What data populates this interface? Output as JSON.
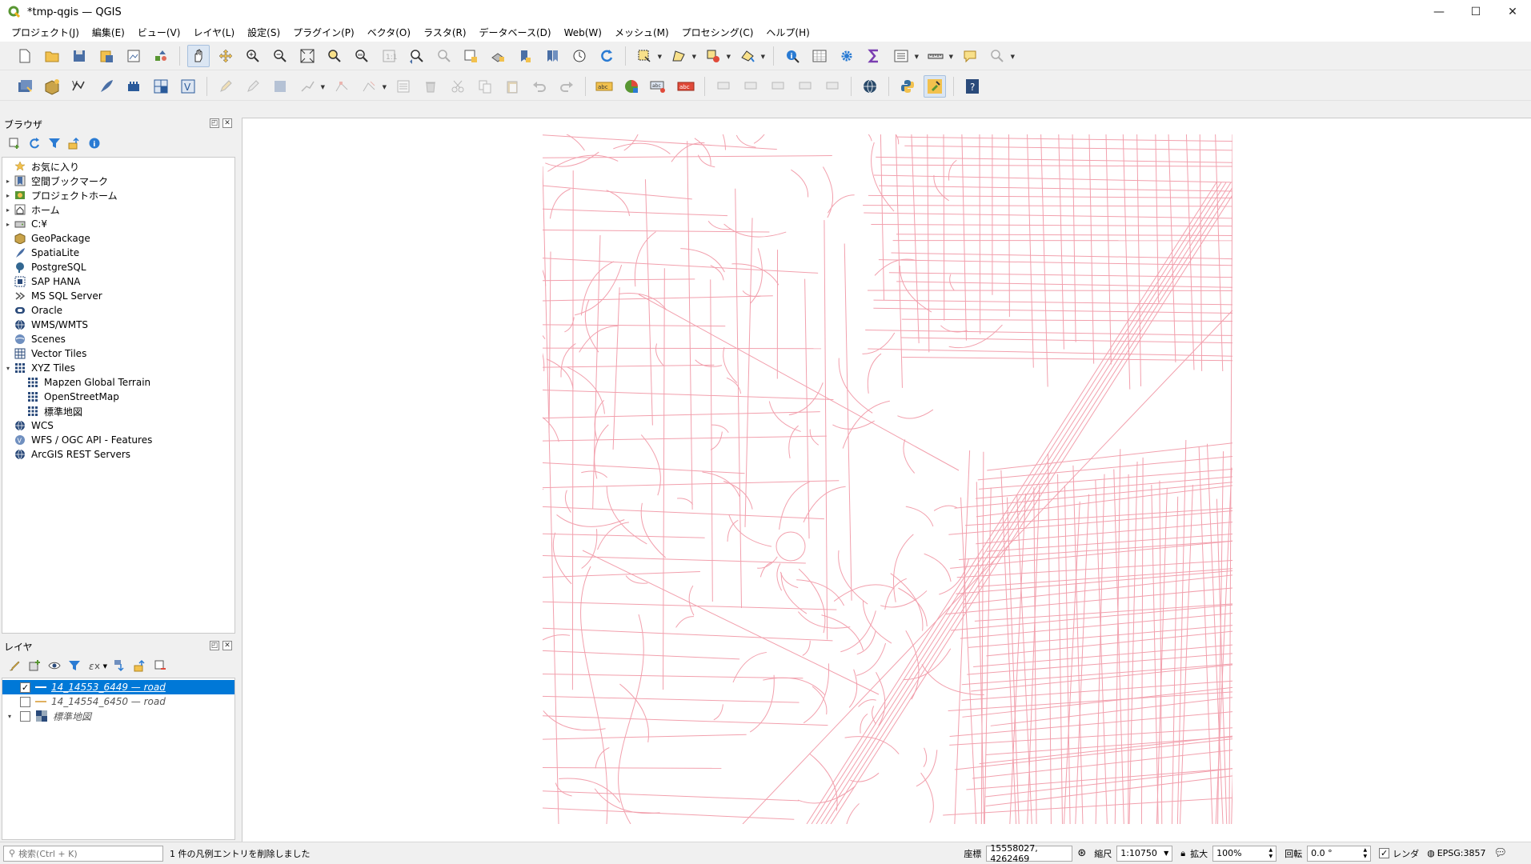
{
  "window": {
    "title": "*tmp-qgis — QGIS",
    "minimize": "—",
    "maximize": "☐",
    "close": "✕"
  },
  "menu": [
    "プロジェクト(J)",
    "編集(E)",
    "ビュー(V)",
    "レイヤ(L)",
    "設定(S)",
    "プラグイン(P)",
    "ベクタ(O)",
    "ラスタ(R)",
    "データベース(D)",
    "Web(W)",
    "メッシュ(M)",
    "プロセシング(C)",
    "ヘルプ(H)"
  ],
  "browser": {
    "title": "ブラウザ",
    "items": [
      {
        "label": "お気に入り",
        "icon": "star-icon",
        "expand": ""
      },
      {
        "label": "空間ブックマーク",
        "icon": "bookmark-icon",
        "expand": "▸"
      },
      {
        "label": "プロジェクトホーム",
        "icon": "project-home-icon",
        "expand": "▸"
      },
      {
        "label": "ホーム",
        "icon": "home-icon",
        "expand": "▸"
      },
      {
        "label": "C:¥",
        "icon": "drive-icon",
        "expand": "▸"
      },
      {
        "label": "GeoPackage",
        "icon": "geopackage-icon",
        "expand": ""
      },
      {
        "label": "SpatiaLite",
        "icon": "spatialite-icon",
        "expand": ""
      },
      {
        "label": "PostgreSQL",
        "icon": "postgresql-icon",
        "expand": ""
      },
      {
        "label": "SAP HANA",
        "icon": "sap-hana-icon",
        "expand": ""
      },
      {
        "label": "MS SQL Server",
        "icon": "mssql-icon",
        "expand": ""
      },
      {
        "label": "Oracle",
        "icon": "oracle-icon",
        "expand": ""
      },
      {
        "label": "WMS/WMTS",
        "icon": "globe-icon",
        "expand": ""
      },
      {
        "label": "Scenes",
        "icon": "scenes-icon",
        "expand": ""
      },
      {
        "label": "Vector Tiles",
        "icon": "vector-tiles-icon",
        "expand": ""
      },
      {
        "label": "XYZ Tiles",
        "icon": "xyz-tiles-icon",
        "expand": "▾"
      },
      {
        "label": "Mapzen Global Terrain",
        "icon": "xyz-tiles-icon",
        "expand": "",
        "indent": true
      },
      {
        "label": "OpenStreetMap",
        "icon": "xyz-tiles-icon",
        "expand": "",
        "indent": true
      },
      {
        "label": "標準地図",
        "icon": "xyz-tiles-icon",
        "expand": "",
        "indent": true
      },
      {
        "label": "WCS",
        "icon": "globe-icon",
        "expand": ""
      },
      {
        "label": "WFS / OGC API - Features",
        "icon": "wfs-icon",
        "expand": ""
      },
      {
        "label": "ArcGIS REST Servers",
        "icon": "globe-icon",
        "expand": ""
      }
    ]
  },
  "layers": {
    "title": "レイヤ",
    "items": [
      {
        "name": "14_14553_6449 — road",
        "checked": true,
        "selected": true,
        "color": "#f4a3b0"
      },
      {
        "name": "14_14554_6450 — road",
        "checked": false,
        "selected": false,
        "color": "#e0b060"
      },
      {
        "name": "標準地図",
        "checked": false,
        "selected": false,
        "raster": true
      }
    ]
  },
  "colors": {
    "road": "#f2a0ad",
    "selection": "#0078d7"
  },
  "status": {
    "search_placeholder": "検索(Ctrl + K)",
    "message": "1 件の凡例エントリを削除しました",
    "coord_label": "座標",
    "coord_value": "15558027, 4262469",
    "scale_label": "縮尺",
    "scale_value": "1:10750",
    "magnify_label": "拡大",
    "magnify_value": "100%",
    "rotation_label": "回転",
    "rotation_value": "0.0 °",
    "render_label": "レンダ",
    "render_checked": "✓",
    "crs": "EPSG:3857"
  }
}
